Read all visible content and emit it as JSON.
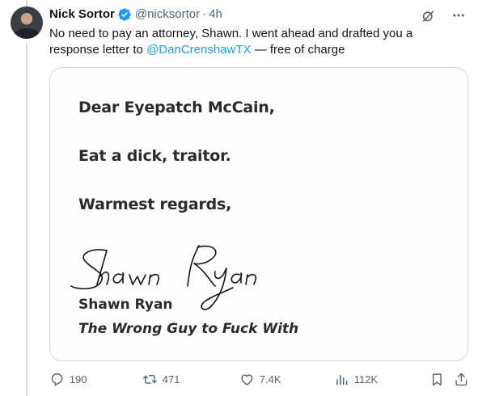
{
  "tweet": {
    "author_name": "Nick Sortor",
    "handle": "@nicksortor",
    "separator": "·",
    "time": "4h",
    "text_part1": "No need to pay an attorney, Shawn. I went ahead and drafted you a response letter to ",
    "mention": "@DanCrenshawTX",
    "text_part2": " — free of charge",
    "verified": true
  },
  "media": {
    "greeting": "Dear Eyepatch McCain,",
    "body": "Eat a dick, traitor.",
    "closing": "Warmest regards,",
    "signature_script": "Shawn Ryan",
    "signer_name": "Shawn Ryan",
    "tagline": "The Wrong Guy to Fuck With"
  },
  "actions": {
    "replies": "190",
    "retweets": "471",
    "likes": "7.4K",
    "views": "112K"
  },
  "colors": {
    "accent": "#1d9bf0",
    "secondary_text": "#536471",
    "border": "#cfd9de"
  }
}
